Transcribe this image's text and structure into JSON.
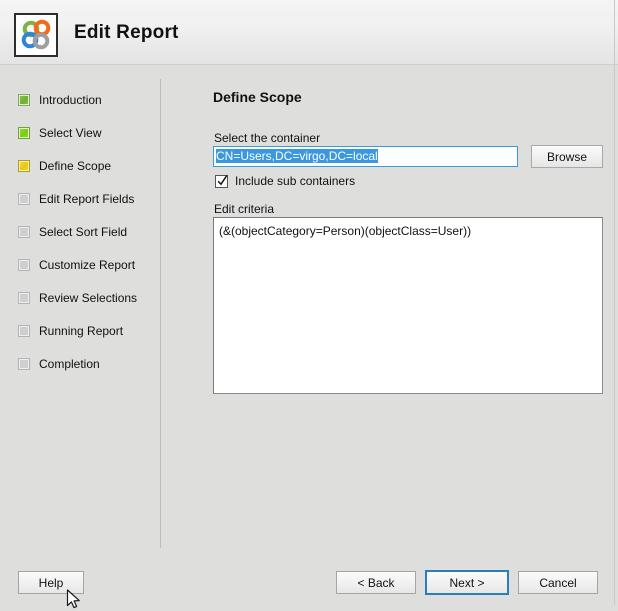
{
  "header": {
    "title": "Edit Report",
    "icon_name": "report-app-icon",
    "icon_ring_colors": {
      "top_left": "#7cb342",
      "top_right": "#ef6c1a",
      "bottom_left": "#2f86d6",
      "bottom_right": "#9e9e9e"
    }
  },
  "sidebar": {
    "items": [
      {
        "label": "Introduction",
        "state": "green-dull"
      },
      {
        "label": "Select View",
        "state": "green"
      },
      {
        "label": "Define Scope",
        "state": "yellow"
      },
      {
        "label": "Edit Report Fields",
        "state": "gray"
      },
      {
        "label": "Select Sort Field",
        "state": "gray"
      },
      {
        "label": "Customize Report",
        "state": "gray"
      },
      {
        "label": "Review Selections",
        "state": "gray"
      },
      {
        "label": "Running Report",
        "state": "gray"
      },
      {
        "label": "Completion",
        "state": "gray"
      }
    ]
  },
  "main": {
    "section_title": "Define Scope",
    "container_label": "Select the container",
    "container_value": "CN=Users,DC=virgo,DC=local",
    "container_selected": true,
    "browse_label": "Browse",
    "subcontainers_label": "Include sub containers",
    "subcontainers_checked": true,
    "criteria_label": "Edit criteria",
    "criteria_value": "(&(objectCategory=Person)(objectClass=User))"
  },
  "footer": {
    "help_label": "Help",
    "back_label": "< Back",
    "next_label": "Next >",
    "cancel_label": "Cancel",
    "default_button": "next-button"
  },
  "colors": {
    "window_background": "#dededd",
    "header_background": "#f1f1f1",
    "focus_blue": "#2a7ec0",
    "selection_blue": "#3b97e0",
    "step_green": "#79cc10",
    "step_yellow": "#e6c716",
    "step_gray": "#cfcfcf"
  }
}
